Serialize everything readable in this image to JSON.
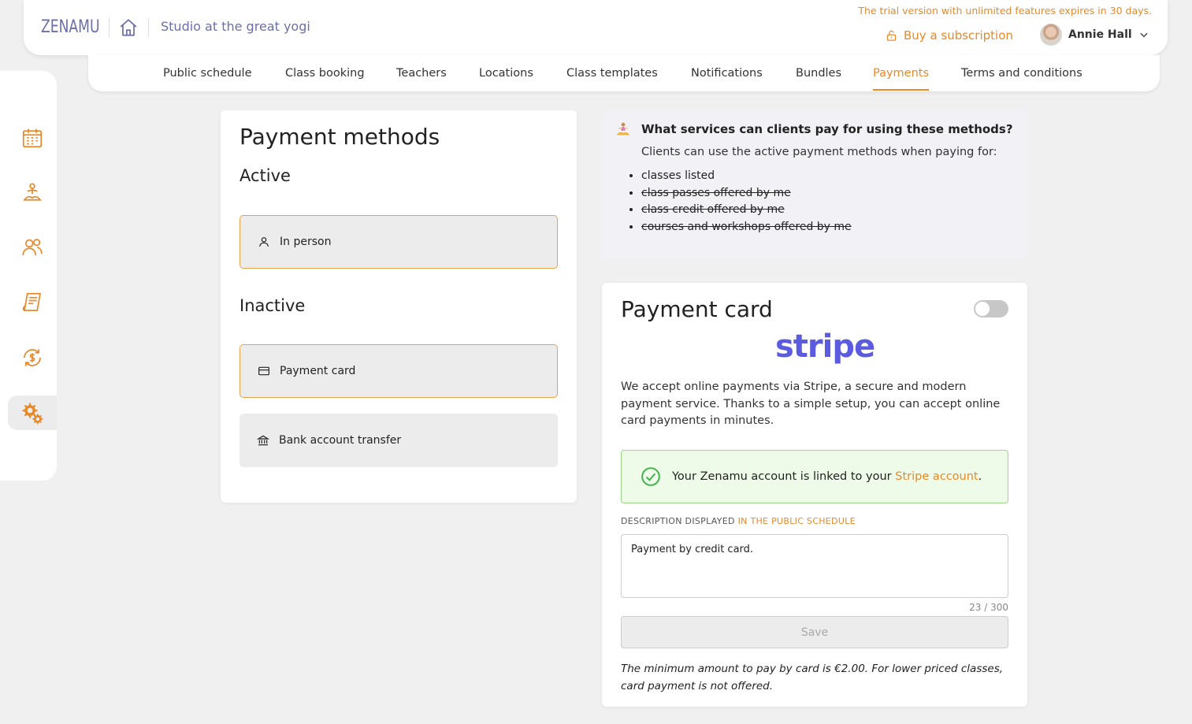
{
  "header": {
    "logo": "ZENAMU",
    "studio_name": "Studio at the great yogi",
    "trial_notice": "The trial version with unlimited features expires in 30 days.",
    "buy_label": "Buy a subscription",
    "user_name": "Annie Hall"
  },
  "tabs": [
    {
      "label": "Public schedule"
    },
    {
      "label": "Class booking"
    },
    {
      "label": "Teachers"
    },
    {
      "label": "Locations"
    },
    {
      "label": "Class templates"
    },
    {
      "label": "Notifications"
    },
    {
      "label": "Bundles"
    },
    {
      "label": "Payments",
      "active": true
    },
    {
      "label": "Terms and conditions"
    }
  ],
  "sidebar": {
    "items": [
      {
        "icon": "calendar-icon"
      },
      {
        "icon": "yoga-icon"
      },
      {
        "icon": "people-icon"
      },
      {
        "icon": "receipt-icon"
      },
      {
        "icon": "money-refresh-icon"
      },
      {
        "icon": "settings-gears-icon",
        "active": true
      }
    ]
  },
  "payment_methods": {
    "title": "Payment methods",
    "active_heading": "Active",
    "inactive_heading": "Inactive",
    "active": [
      {
        "label": "In person",
        "icon": "person-icon"
      }
    ],
    "inactive": [
      {
        "label": "Payment card",
        "icon": "card-icon"
      },
      {
        "label": "Bank account transfer",
        "icon": "bank-icon"
      }
    ]
  },
  "info": {
    "title": "What services can clients pay for using these methods?",
    "text": "Clients can use the active payment methods when paying for:",
    "items": [
      {
        "label": "classes listed",
        "struck": false
      },
      {
        "label": "class passes offered by me",
        "struck": true
      },
      {
        "label": "class credit offered by me",
        "struck": true
      },
      {
        "label": "courses and workshops offered by me",
        "struck": true
      }
    ]
  },
  "payment_card": {
    "title": "Payment card",
    "enabled": false,
    "provider_logo": "stripe",
    "description": "We accept online payments via Stripe, a secure and modern payment service. Thanks to a simple setup, you can accept online card payments in minutes.",
    "linked_text": "Your Zenamu account is linked to your ",
    "linked_link": "Stripe account",
    "linked_end": ".",
    "desc_label": "DESCRIPTION DISPLAYED ",
    "desc_label_highlight": "IN THE PUBLIC SCHEDULE",
    "desc_value": "Payment by credit card.",
    "counter": "23 / 300",
    "save_label": "Save",
    "note": "The minimum amount to pay by card is €2.00. For lower priced classes, card payment is not offered."
  },
  "colors": {
    "accent": "#e8892a",
    "brand": "#6b6fa8",
    "stripe": "#5b5be0",
    "success_bg": "#effbe9"
  }
}
